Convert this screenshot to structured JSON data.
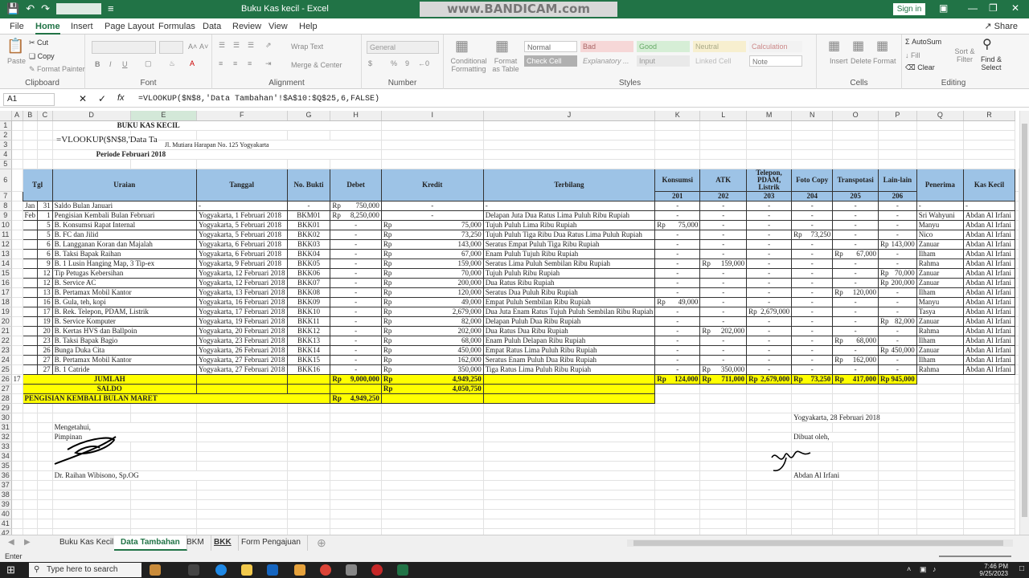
{
  "titlebar": {
    "autosave_icon": "save-icon",
    "title": "Buku Kas kecil - Excel",
    "watermark": "www.BANDICAM.com",
    "signin": "Sign in"
  },
  "menu": {
    "tabs": [
      "File",
      "Home",
      "Insert",
      "Page Layout",
      "Formulas",
      "Data",
      "Review",
      "View",
      "Help"
    ],
    "active": "Home",
    "share": "Share"
  },
  "ribbon": {
    "clipboard": {
      "paste": "Paste",
      "cut": "Cut",
      "copy": "Copy",
      "format_painter": "Format Painter",
      "label": "Clipboard"
    },
    "font": {
      "label": "Font"
    },
    "alignment": {
      "wrap": "Wrap Text",
      "merge": "Merge & Center",
      "label": "Alignment"
    },
    "number": {
      "format": "General",
      "label": "Number"
    },
    "styles": {
      "conditional": "Conditional Formatting",
      "format_table": "Format as Table",
      "cells": [
        "Normal",
        "Bad",
        "Good",
        "Neutral",
        "Calculation",
        "Check Cell",
        "Explanatory ...",
        "Input",
        "Linked Cell",
        "Note"
      ],
      "label": "Styles"
    },
    "cells": {
      "insert": "Insert",
      "delete": "Delete",
      "format": "Format",
      "label": "Cells"
    },
    "editing": {
      "autosum": "AutoSum",
      "fill": "Fill",
      "clear": "Clear",
      "sort": "Sort & Filter",
      "find": "Find & Select",
      "label": "Editing"
    }
  },
  "formula_bar": {
    "name_box": "A1",
    "formula": "=VLOOKUP($N$8,'Data Tambahan'!$A$10:$Q$25,6,FALSE)"
  },
  "sheet": {
    "columns": [
      "A",
      "B",
      "C",
      "D",
      "E",
      "F",
      "G",
      "H",
      "I",
      "J",
      "K",
      "L",
      "M",
      "N",
      "O",
      "P",
      "Q",
      "R"
    ],
    "top_title": "BUKU KAS KECIL",
    "overlay_formula": "=VLOOKUP($N$8,'Data Ta",
    "address": "Jl. Mutiara Harapan No. 125 Yogyakarta",
    "period": "Periode Februari 2018",
    "headers": {
      "tgl": "Tgl",
      "uraian": "Uraian",
      "tanggal": "Tanggal",
      "bukti": "No. Bukti",
      "debet": "Debet",
      "kredit": "Kredit",
      "terbilang": "Terbilang",
      "konsumsi": "Konsumsi",
      "atk": "ATK",
      "telepon": "Telepon, PDAM, Listrik",
      "fotocopy": "Foto Copy",
      "transport": "Transpotasi",
      "lain": "Lain-lain",
      "penerima": "Penerima",
      "kaskecil": "Kas Kecil"
    },
    "codes": [
      "201",
      "202",
      "203",
      "204",
      "205",
      "206"
    ],
    "rows": [
      {
        "m": "Jan",
        "d": "31",
        "u": "Saldo Bulan Januari",
        "t": "-",
        "b": "-",
        "deb": "750,000",
        "kr": "-",
        "tb": "-",
        "k": [
          "-",
          "-",
          "-",
          "-",
          "-",
          "-"
        ],
        "p": "-",
        "kk": "-"
      },
      {
        "m": "Feb",
        "d": "1",
        "u": "Pengisian Kembali Bulan Februari",
        "t": "Yogyakarta, 1 Februari 2018",
        "b": "BKM01",
        "deb": "8,250,000",
        "kr": "-",
        "tb": "Delapan Juta Dua Ratus Lima Puluh Ribu Rupiah",
        "k": [
          "-",
          "-",
          "-",
          "-",
          "-",
          "-"
        ],
        "p": "Sri Wahyuni",
        "kk": "Abdan Al Irfani"
      },
      {
        "m": "",
        "d": "5",
        "u": "B. Konsumsi Rapat Internal",
        "t": "Yogyakarta, 5 Februari 2018",
        "b": "BKK01",
        "deb": "-",
        "kr": "75,000",
        "tb": "Tujuh Puluh Lima Ribu Rupiah",
        "k": [
          "75,000",
          "-",
          "-",
          "-",
          "-",
          "-"
        ],
        "p": "Manyu",
        "kk": "Abdan Al Irfani"
      },
      {
        "m": "",
        "d": "5",
        "u": "B. FC dan Jilid",
        "t": "Yogyakarta, 5 Februari 2018",
        "b": "BKK02",
        "deb": "-",
        "kr": "73,250",
        "tb": "Tujuh Puluh Tiga Ribu Dua Ratus Lima Puluh Rupiah",
        "k": [
          "-",
          "-",
          "-",
          "73,250",
          "-",
          "-"
        ],
        "p": "Nico",
        "kk": "Abdan Al Irfani"
      },
      {
        "m": "",
        "d": "6",
        "u": "B. Langganan Koran dan Majalah",
        "t": "Yogyakarta, 6 Februari 2018",
        "b": "BKK03",
        "deb": "-",
        "kr": "143,000",
        "tb": "Seratus Empat Puluh Tiga Ribu Rupiah",
        "k": [
          "-",
          "-",
          "-",
          "-",
          "-",
          "143,000"
        ],
        "p": "Zanuar",
        "kk": "Abdan Al Irfani"
      },
      {
        "m": "",
        "d": "6",
        "u": "B. Taksi Bapak Raihan",
        "t": "Yogyakarta, 6 Februari 2018",
        "b": "BKK04",
        "deb": "-",
        "kr": "67,000",
        "tb": "Enam Puluh Tujuh Ribu Rupiah",
        "k": [
          "-",
          "-",
          "-",
          "-",
          "67,000",
          "-"
        ],
        "p": "Ilham",
        "kk": "Abdan Al Irfani"
      },
      {
        "m": "",
        "d": "9",
        "u": "B. 1 Lusin Hanging Map, 3 Tip-ex",
        "t": "Yogyakarta, 9 Februari 2018",
        "b": "BKK05",
        "deb": "-",
        "kr": "159,000",
        "tb": "Seratus Lima Puluh Sembilan Ribu Rupiah",
        "k": [
          "-",
          "159,000",
          "-",
          "-",
          "-",
          "-"
        ],
        "p": "Rahma",
        "kk": "Abdan Al Irfani"
      },
      {
        "m": "",
        "d": "12",
        "u": "Tip Petugas Kebersihan",
        "t": "Yogyakarta, 12 Februari 2018",
        "b": "BKK06",
        "deb": "-",
        "kr": "70,000",
        "tb": "Tujuh Puluh Ribu Rupiah",
        "k": [
          "-",
          "-",
          "-",
          "-",
          "-",
          "70,000"
        ],
        "p": "Zanuar",
        "kk": "Abdan Al Irfani"
      },
      {
        "m": "",
        "d": "12",
        "u": "B. Service AC",
        "t": "Yogyakarta, 12 Februari 2018",
        "b": "BKK07",
        "deb": "-",
        "kr": "200,000",
        "tb": "Dua Ratus Ribu Rupiah",
        "k": [
          "-",
          "-",
          "-",
          "-",
          "-",
          "200,000"
        ],
        "p": "Zanuar",
        "kk": "Abdan Al Irfani"
      },
      {
        "m": "",
        "d": "13",
        "u": "B. Pertamax Mobil Kantor",
        "t": "Yogyakarta, 13 Februari 2018",
        "b": "BKK08",
        "deb": "-",
        "kr": "120,000",
        "tb": "Seratus Dua Puluh Ribu Rupiah",
        "k": [
          "-",
          "-",
          "-",
          "-",
          "120,000",
          "-"
        ],
        "p": "Ilham",
        "kk": "Abdan Al Irfani"
      },
      {
        "m": "",
        "d": "16",
        "u": "B. Gula, teh, kopi",
        "t": "Yogyakarta, 16 Februari 2018",
        "b": "BKK09",
        "deb": "-",
        "kr": "49,000",
        "tb": "Empat Puluh Sembilan Ribu Rupiah",
        "k": [
          "49,000",
          "-",
          "-",
          "-",
          "-",
          "-"
        ],
        "p": "Manyu",
        "kk": "Abdan Al Irfani"
      },
      {
        "m": "",
        "d": "17",
        "u": "B. Rek. Telepon, PDAM, Listrik",
        "t": "Yogyakarta, 17 Februari 2018",
        "b": "BKK10",
        "deb": "-",
        "kr": "2,679,000",
        "tb": "Dua Juta Enam Ratus Tujuh Puluh Sembilan Ribu Rupiah",
        "k": [
          "-",
          "-",
          "2,679,000",
          "-",
          "-",
          "-"
        ],
        "p": "Tasya",
        "kk": "Abdan Al Irfani"
      },
      {
        "m": "",
        "d": "19",
        "u": "B. Service Komputer",
        "t": "Yogyakarta, 19 Februari 2018",
        "b": "BKK11",
        "deb": "-",
        "kr": "82,000",
        "tb": "Delapan Puluh Dua Ribu Rupiah",
        "k": [
          "-",
          "-",
          "-",
          "-",
          "-",
          "82,000"
        ],
        "p": "Zanuar",
        "kk": "Abdan Al Irfani"
      },
      {
        "m": "",
        "d": "20",
        "u": "B. Kertas HVS dan Ballpoin",
        "t": "Yogyakarta, 20 Februari 2018",
        "b": "BKK12",
        "deb": "-",
        "kr": "202,000",
        "tb": "Dua Ratus Dua Ribu Rupiah",
        "k": [
          "-",
          "202,000",
          "-",
          "-",
          "-",
          "-"
        ],
        "p": "Rahma",
        "kk": "Abdan Al Irfani"
      },
      {
        "m": "",
        "d": "23",
        "u": "B. Taksi Bapak Bagio",
        "t": "Yogyakarta, 23 Februari 2018",
        "b": "BKK13",
        "deb": "-",
        "kr": "68,000",
        "tb": "Enam Puluh Delapan Ribu Rupiah",
        "k": [
          "-",
          "-",
          "-",
          "-",
          "68,000",
          "-"
        ],
        "p": "Ilham",
        "kk": "Abdan Al Irfani"
      },
      {
        "m": "",
        "d": "26",
        "u": "Bunga Duka Cita",
        "t": "Yogyakarta, 26 Februari 2018",
        "b": "BKK14",
        "deb": "-",
        "kr": "450,000",
        "tb": "Empat Ratus Lima Puluh Ribu Rupiah",
        "k": [
          "-",
          "-",
          "-",
          "-",
          "-",
          "450,000"
        ],
        "p": "Zanuar",
        "kk": "Abdan Al Irfani"
      },
      {
        "m": "",
        "d": "27",
        "u": "B. Pertamax Mobil Kantor",
        "t": "Yogyakarta, 27 Februari 2018",
        "b": "BKK15",
        "deb": "-",
        "kr": "162,000",
        "tb": "Seratus Enam Puluh Dua Ribu Rupiah",
        "k": [
          "-",
          "-",
          "-",
          "-",
          "162,000",
          "-"
        ],
        "p": "Ilham",
        "kk": "Abdan Al Irfani"
      },
      {
        "m": "",
        "d": "27",
        "u": "B. 1 Catride",
        "t": "Yogyakarta, 27 Februari 2018",
        "b": "BKK16",
        "deb": "-",
        "kr": "350,000",
        "tb": "Tiga Ratus Lima Puluh Ribu Rupiah",
        "k": [
          "-",
          "350,000",
          "-",
          "-",
          "-",
          "-"
        ],
        "p": "Rahma",
        "kk": "Abdan Al Irfani"
      }
    ],
    "rp": "Rp",
    "row26_a": "17",
    "jumlah": {
      "label": "JUMLAH",
      "deb": "9,000,000",
      "kr": "4,949,250",
      "k": [
        "124,000",
        "711,000",
        "2,679,000",
        "73,250",
        "417,000",
        "945,000"
      ]
    },
    "saldo": {
      "label": "SALDO",
      "kr": "4,050,750"
    },
    "pengisian": {
      "label": "PENGISIAN KEMBALI BULAN MARET",
      "deb": "4,949,250"
    },
    "signature": {
      "left1": "Mengetahui,",
      "left2": "Pimpinan",
      "left_name": "Dr. Raihan Wibisono, Sp.OG",
      "right_date": "Yogyakarta, 28 Februari 2018",
      "right1": "Dibuat oleh,",
      "right_name": "Abdan Al Irfani"
    }
  },
  "sheet_tabs": [
    "Buku Kas Kecil",
    "Data Tambahan",
    "BKM",
    "BKK",
    "Form Pengajuan"
  ],
  "active_sheet": "Data Tambahan",
  "status": {
    "mode": "Enter"
  },
  "taskbar": {
    "search": "Type here to search",
    "time": "7:46 PM",
    "date": "9/25/2023"
  }
}
